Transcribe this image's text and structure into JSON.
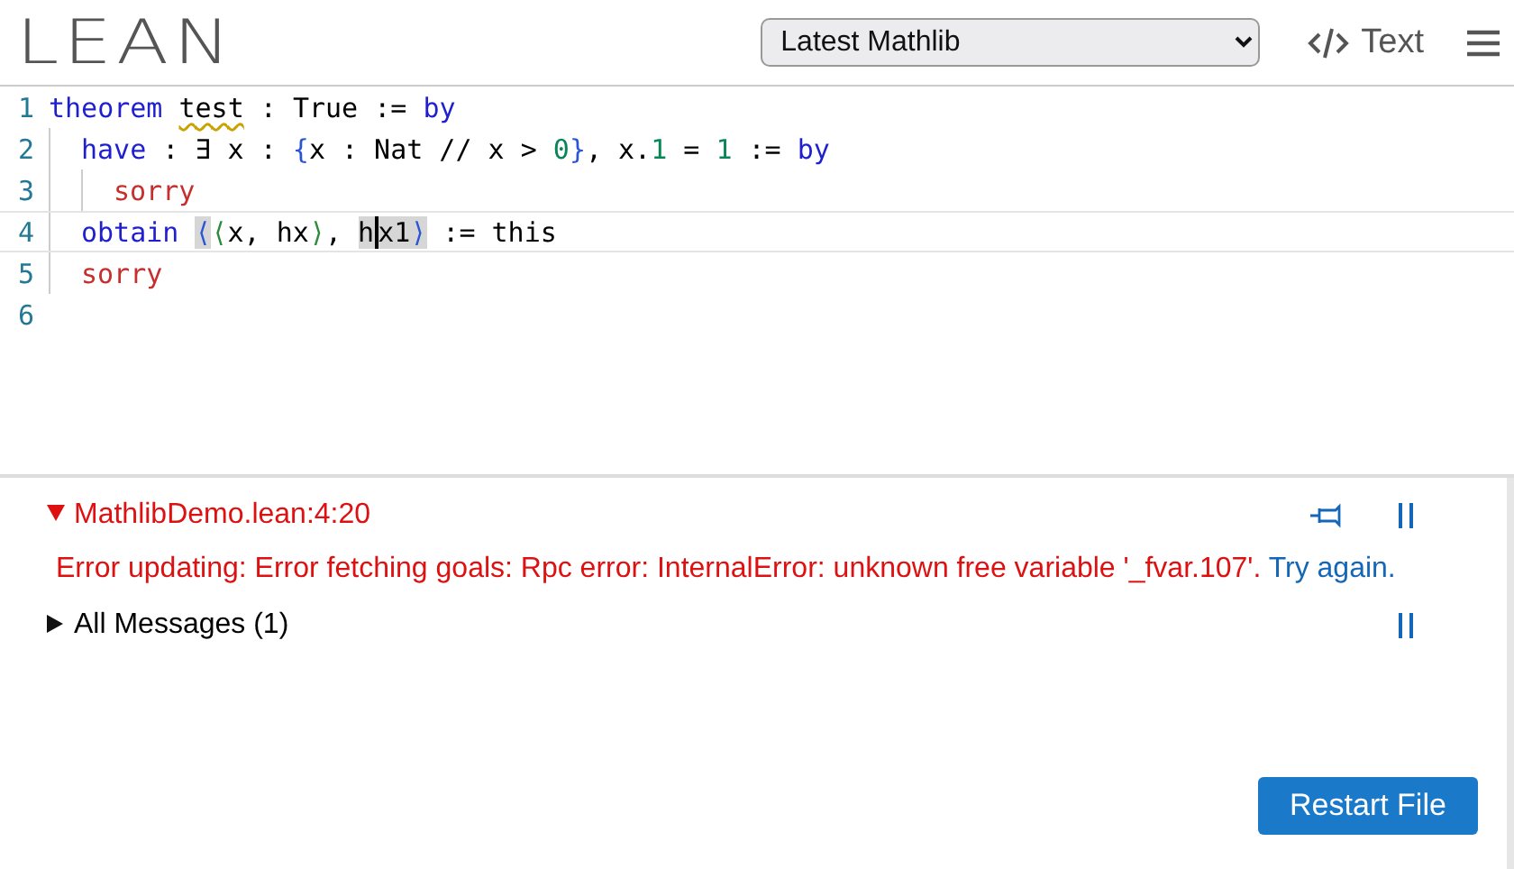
{
  "header": {
    "logo": "LEAN",
    "project_select": {
      "value": "Latest Mathlib"
    },
    "view_toggle": {
      "label": "Text"
    }
  },
  "editor": {
    "lines": [
      {
        "number": "1",
        "current": false,
        "tokens": [
          {
            "text": "theorem ",
            "kind": "keyword"
          },
          {
            "text": "test",
            "kind": "warning"
          },
          {
            "text": " : True := ",
            "kind": "plain"
          },
          {
            "text": "by",
            "kind": "keyword"
          }
        ],
        "children": [
          {
            "number": "2",
            "current": false,
            "tokens": [
              {
                "text": "have",
                "kind": "keyword"
              },
              {
                "text": " : ∃ x : ",
                "kind": "plain"
              },
              {
                "text": "{",
                "kind": "bracket"
              },
              {
                "text": "x : Nat // x > ",
                "kind": "plain"
              },
              {
                "text": "0",
                "kind": "number"
              },
              {
                "text": "}",
                "kind": "bracket"
              },
              {
                "text": ", x.",
                "kind": "plain"
              },
              {
                "text": "1",
                "kind": "number"
              },
              {
                "text": " = ",
                "kind": "plain"
              },
              {
                "text": "1",
                "kind": "number"
              },
              {
                "text": " := ",
                "kind": "plain"
              },
              {
                "text": "by",
                "kind": "keyword"
              }
            ],
            "children": [
              {
                "number": "3",
                "current": false,
                "tokens": [
                  {
                    "text": "sorry",
                    "kind": "error"
                  }
                ]
              }
            ]
          },
          {
            "number": "4",
            "current": true,
            "tokens": [
              {
                "text": "obtain ",
                "kind": "keyword"
              },
              {
                "text": "⟨",
                "kind": "bracket",
                "highlighted": true
              },
              {
                "text": "⟨",
                "kind": "bracket2"
              },
              {
                "text": "x, hx",
                "kind": "plain"
              },
              {
                "text": "⟩",
                "kind": "bracket2"
              },
              {
                "text": ", ",
                "kind": "plain"
              },
              {
                "text": "h",
                "kind": "plain",
                "highlighted": true
              },
              {
                "text": "x1",
                "kind": "plain",
                "highlighted": true,
                "cursor": true
              },
              {
                "text": "⟩",
                "kind": "bracket",
                "highlighted": true
              },
              {
                "text": " := this",
                "kind": "plain"
              }
            ]
          },
          {
            "number": "5",
            "current": false,
            "tokens": [
              {
                "text": "sorry",
                "kind": "error"
              }
            ]
          }
        ]
      },
      {
        "number": "6",
        "current": false
      }
    ]
  },
  "infoview": {
    "location": {
      "label": "MathlibDemo.lean:4:20",
      "expanded": true
    },
    "error": {
      "message": "Error updating: Error fetching goals: Rpc error: InternalError: unknown free variable '_fvar.107'.",
      "link": "Try again."
    },
    "all_messages": {
      "label": "All Messages (1)",
      "expanded": false
    },
    "restart_button": "Restart File"
  }
}
